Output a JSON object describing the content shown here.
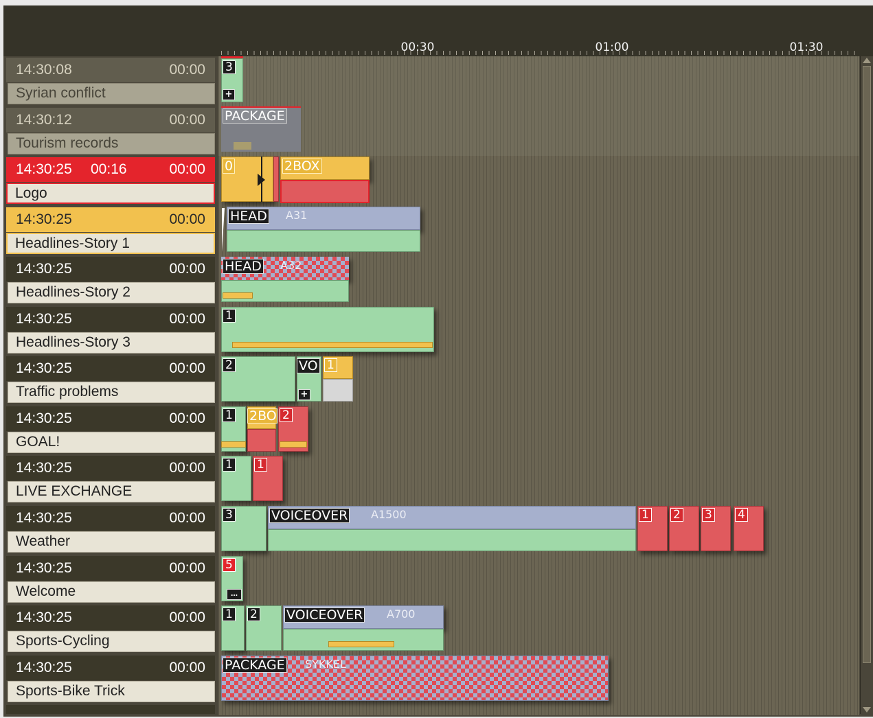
{
  "ruler": {
    "labels": [
      "00:30",
      "01:00",
      "01:30"
    ]
  },
  "rundown": [
    {
      "start": "14:30:08",
      "duration": "",
      "end": "00:00",
      "title": "Syrian conflict",
      "state": "dim"
    },
    {
      "start": "14:30:12",
      "duration": "",
      "end": "00:00",
      "title": "Tourism records",
      "state": "dim"
    },
    {
      "start": "14:30:25",
      "duration": "00:16",
      "end": "00:00",
      "title": "Logo",
      "state": "on-air"
    },
    {
      "start": "14:30:25",
      "duration": "",
      "end": "00:00",
      "title": "Headlines-Story 1",
      "state": "next"
    },
    {
      "start": "14:30:25",
      "duration": "",
      "end": "00:00",
      "title": "Headlines-Story 2",
      "state": "normal"
    },
    {
      "start": "14:30:25",
      "duration": "",
      "end": "00:00",
      "title": "Headlines-Story 3",
      "state": "normal"
    },
    {
      "start": "14:30:25",
      "duration": "",
      "end": "00:00",
      "title": "Traffic problems",
      "state": "normal"
    },
    {
      "start": "14:30:25",
      "duration": "",
      "end": "00:00",
      "title": "GOAL!",
      "state": "normal"
    },
    {
      "start": "14:30:25",
      "duration": "",
      "end": "00:00",
      "title": "LIVE EXCHANGE",
      "state": "normal"
    },
    {
      "start": "14:30:25",
      "duration": "",
      "end": "00:00",
      "title": "Weather",
      "state": "normal"
    },
    {
      "start": "14:30:25",
      "duration": "",
      "end": "00:00",
      "title": "Welcome",
      "state": "normal"
    },
    {
      "start": "14:30:25",
      "duration": "",
      "end": "00:00",
      "title": "Sports-Cycling",
      "state": "normal"
    },
    {
      "start": "14:30:25",
      "duration": "",
      "end": "00:00",
      "title": "Sports-Bike Trick",
      "state": "normal"
    }
  ],
  "timeline": {
    "r0": {
      "num": "3"
    },
    "r1": {
      "label": "PACKAGE"
    },
    "r2": {
      "num": "0",
      "label": "2BOX"
    },
    "r3": {
      "label": "HEAD",
      "sub": "A31"
    },
    "r4": {
      "label": "HEAD",
      "sub": "A32"
    },
    "r5": {
      "num": "1"
    },
    "r6": {
      "num": "2",
      "label": "VO",
      "num2": "1"
    },
    "r7": {
      "num": "1",
      "label": "2BO",
      "num2": "2"
    },
    "r8": {
      "num": "1",
      "num2": "1"
    },
    "r9": {
      "num": "3",
      "label": "VOICEOVER",
      "sub": "A1500",
      "cams": [
        "1",
        "2",
        "3",
        "4"
      ]
    },
    "r10": {
      "num": "5"
    },
    "r11": {
      "num": "1",
      "num2": "2",
      "label": "VOICEOVER",
      "sub": "A700"
    },
    "r12": {
      "label": "PACKAGE",
      "sub": "SYKKEL"
    }
  },
  "colors": {
    "on_air": "#e4242c",
    "next": "#f2c14e",
    "clip_green": "#9fd9a8",
    "clip_blue": "#a6b0cd",
    "clip_red": "#e05a5e"
  }
}
